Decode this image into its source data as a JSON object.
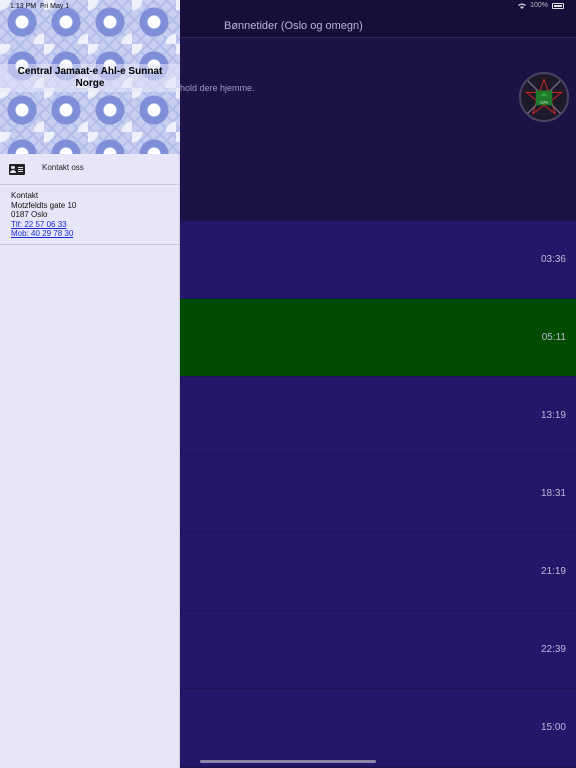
{
  "status_bar": {
    "time": "1:13 PM",
    "date": "Fri May 1",
    "battery_text": "100%"
  },
  "nav": {
    "title": "Bønnetider (Oslo og omegn)"
  },
  "header": {
    "text": "hold dere hjemme."
  },
  "logo": {
    "text": "CJAS"
  },
  "prayer_times": [
    {
      "time": "03:36",
      "active": false
    },
    {
      "time": "05:11",
      "active": true
    },
    {
      "time": "13:19",
      "active": false
    },
    {
      "time": "18:31",
      "active": false
    },
    {
      "time": "21:19",
      "active": false
    },
    {
      "time": "22:39",
      "active": false
    },
    {
      "time": "15:00",
      "active": false
    }
  ],
  "drawer": {
    "title": "Central Jamaat-e Ahl-e Sunnat Norge",
    "menu_item": "Kontakt oss",
    "contact": {
      "heading": "Kontakt",
      "street": "Motzfeldts gate 10",
      "city": "0187 Oslo",
      "phone": "Tlf: 22 57 06 33",
      "mobile": "Mob: 40 29 78 30"
    }
  },
  "colors": {
    "background": "#1f1450",
    "row": "#23176a",
    "active_row": "#004d00",
    "drawer": "#e6e6f8",
    "link": "#1a2bd6"
  }
}
